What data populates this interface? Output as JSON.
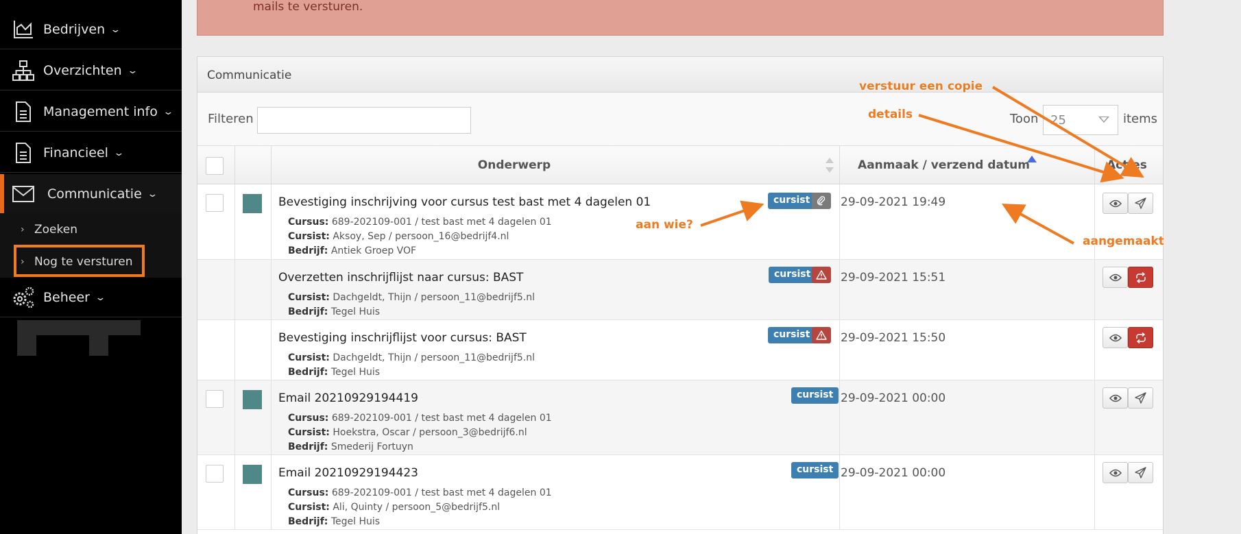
{
  "sidebar": {
    "items": [
      {
        "label": "Bedrijven",
        "icon": "chart-icon"
      },
      {
        "label": "Overzichten",
        "icon": "sitemap-icon"
      },
      {
        "label": "Management info",
        "icon": "document-icon"
      },
      {
        "label": "Financieel",
        "icon": "document-icon"
      },
      {
        "label": "Communicatie",
        "icon": "envelope-icon"
      },
      {
        "label": "Beheer",
        "icon": "gears-icon"
      }
    ],
    "subitems": [
      {
        "label": "Zoeken"
      },
      {
        "label": "Nog te versturen"
      }
    ],
    "chevron": "⌄",
    "sub_arrow": "›"
  },
  "alert": {
    "text": "mails te versturen."
  },
  "panel": {
    "title": "Communicatie",
    "filter_label": "Filteren",
    "filter_value": "",
    "toon_label": "Toon",
    "toon_value": "25",
    "items_label": "items"
  },
  "table": {
    "headers": {
      "subject": "Onderwerp",
      "date": "Aanmaak / verzend datum",
      "actions": "Acties"
    },
    "rows": [
      {
        "subject": "Bevestiging inschrijving voor cursus test bast met 4 dagelen 01",
        "has_checkbox": true,
        "has_square": true,
        "meta": [
          {
            "key": "Cursus:",
            "value": "689-202109-001 / test bast met 4 dagelen 01"
          },
          {
            "key": "Cursist:",
            "value": "Aksoy, Sep / persoon_16@bedrijf4.nl"
          },
          {
            "key": "Bedrijf:",
            "value": "Antiek Groep VOF"
          }
        ],
        "badge": "cursist",
        "status_icon": "paperclip-icon",
        "date": "29-09-2021 19:49",
        "action_icon": "send-icon"
      },
      {
        "subject": "Overzetten inschrijflijst naar cursus: BAST",
        "has_checkbox": false,
        "has_square": false,
        "meta": [
          {
            "key": "Cursist:",
            "value": "Dachgeldt, Thijn / persoon_11@bedrijf5.nl"
          },
          {
            "key": "Bedrijf:",
            "value": "Tegel Huis"
          }
        ],
        "badge": "cursist",
        "status_icon": "warning-icon",
        "date": "29-09-2021 15:51",
        "action_icon": "retry-icon"
      },
      {
        "subject": "Bevestiging inschrijflijst voor cursus: BAST",
        "has_checkbox": false,
        "has_square": false,
        "meta": [
          {
            "key": "Cursist:",
            "value": "Dachgeldt, Thijn / persoon_11@bedrijf5.nl"
          },
          {
            "key": "Bedrijf:",
            "value": "Tegel Huis"
          }
        ],
        "badge": "cursist",
        "status_icon": "warning-icon",
        "date": "29-09-2021 15:50",
        "action_icon": "retry-icon"
      },
      {
        "subject": "Email 20210929194419",
        "has_checkbox": true,
        "has_square": true,
        "meta": [
          {
            "key": "Cursus:",
            "value": "689-202109-001 / test bast met 4 dagelen 01"
          },
          {
            "key": "Cursist:",
            "value": "Hoekstra, Oscar / persoon_3@bedrijf6.nl"
          },
          {
            "key": "Bedrijf:",
            "value": "Smederij Fortuyn"
          }
        ],
        "badge": "cursist",
        "status_icon": "",
        "date": "29-09-2021 00:00",
        "action_icon": "send-icon"
      },
      {
        "subject": "Email 20210929194423",
        "has_checkbox": true,
        "has_square": true,
        "meta": [
          {
            "key": "Cursus:",
            "value": "689-202109-001 / test bast met 4 dagelen 01"
          },
          {
            "key": "Cursist:",
            "value": "Ali, Quinty / persoon_5@bedrijf5.nl"
          },
          {
            "key": "Bedrijf:",
            "value": "Tegel Huis"
          }
        ],
        "badge": "cursist",
        "status_icon": "",
        "date": "29-09-2021 00:00",
        "action_icon": "send-icon"
      }
    ]
  },
  "annotations": {
    "copy": "verstuur een copie",
    "details": "details",
    "recipient": "aan wie?",
    "created": "aangemaakt"
  },
  "colors": {
    "accent": "#ee7a22",
    "badge": "#3c7fb0",
    "danger": "#c63a32",
    "sidebar": "#000000",
    "alert_bg": "#e0a094"
  }
}
